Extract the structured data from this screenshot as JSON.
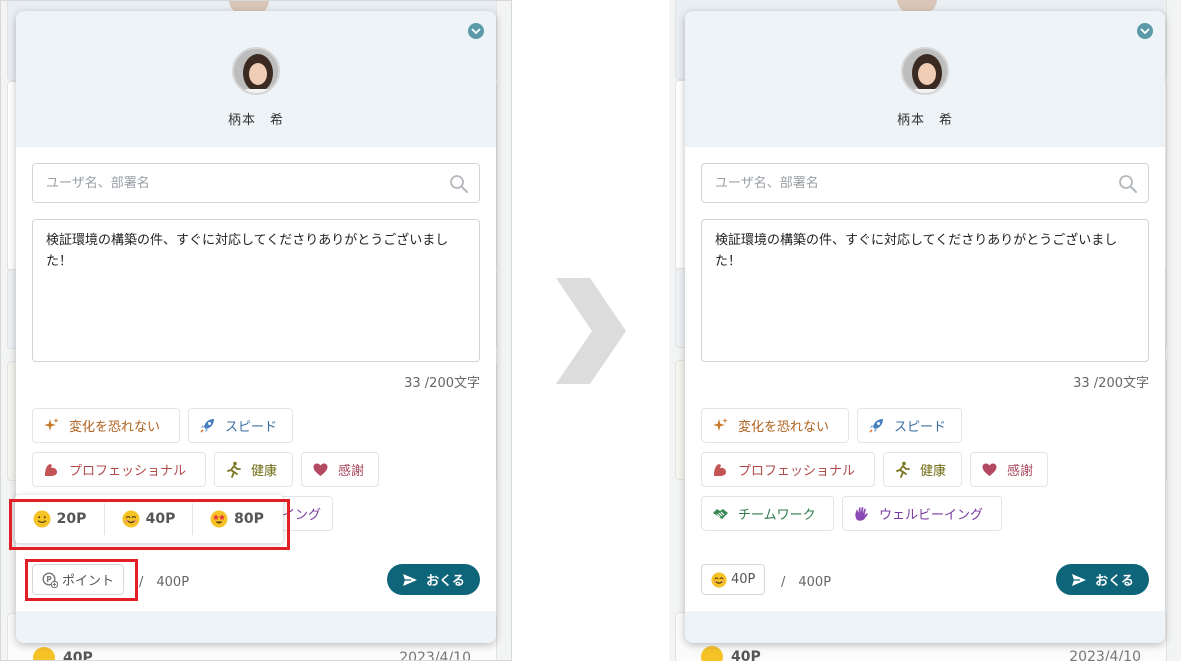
{
  "user": {
    "name": "柄本　希"
  },
  "search": {
    "placeholder": "ユーザ名、部署名"
  },
  "message": {
    "text": "検証環境の構築の件、すぐに対応してくださりありがとうございました！",
    "counter": "33 /200文字"
  },
  "tags": [
    {
      "label": "変化を恐れない",
      "icon": "sparkle-icon",
      "color": "#b0611c"
    },
    {
      "label": "スピード",
      "icon": "rocket-icon",
      "color": "#3b6fa3"
    },
    {
      "label": "プロフェッショナル",
      "icon": "muscle-icon",
      "color": "#b34a4a"
    },
    {
      "label": "健康",
      "icon": "runner-icon",
      "color": "#6f6a12"
    },
    {
      "label": "感謝",
      "icon": "heart-icon",
      "color": "#a8475d"
    },
    {
      "label": "チームワーク",
      "icon": "handshake-icon",
      "color": "#2f7a4a"
    },
    {
      "label": "ウェルビーイング",
      "icon": "waving-hand-icon",
      "color": "#7a3aa0"
    }
  ],
  "tag_partial": "イング",
  "points": {
    "placeholder_label": "ポイント",
    "selected_label": "40P",
    "total": "/　400P",
    "options": [
      {
        "label": "20P",
        "icon": "slight-smile-emoji"
      },
      {
        "label": "40P",
        "icon": "smiling-emoji"
      },
      {
        "label": "80P",
        "icon": "star-eyes-emoji"
      }
    ]
  },
  "send": {
    "label": "おくる",
    "color": "#0e6478"
  },
  "feed": {
    "points": "40P",
    "date": "2023/4/10"
  }
}
